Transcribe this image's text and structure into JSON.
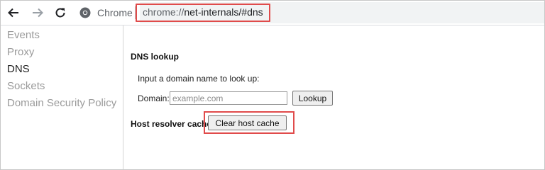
{
  "browser": {
    "site_name": "Chrome",
    "url_prefix": "chrome://",
    "url_path": "net-internals/#dns"
  },
  "sidebar": {
    "items": [
      {
        "label": "Events",
        "active": false
      },
      {
        "label": "Proxy",
        "active": false
      },
      {
        "label": "DNS",
        "active": true
      },
      {
        "label": "Sockets",
        "active": false
      },
      {
        "label": "Domain Security Policy",
        "active": false
      }
    ]
  },
  "main": {
    "dns_lookup_title": "DNS lookup",
    "lookup_instruction": "Input a domain name to look up:",
    "domain_label": "Domain:",
    "domain_placeholder": "example.com",
    "lookup_button": "Lookup",
    "host_cache_label": "Host resolver cache",
    "clear_cache_button": "Clear host cache"
  },
  "colors": {
    "highlight": "#e04b4b",
    "active_nav": "#1f1f1f",
    "inactive_nav": "#9a9a9a"
  }
}
